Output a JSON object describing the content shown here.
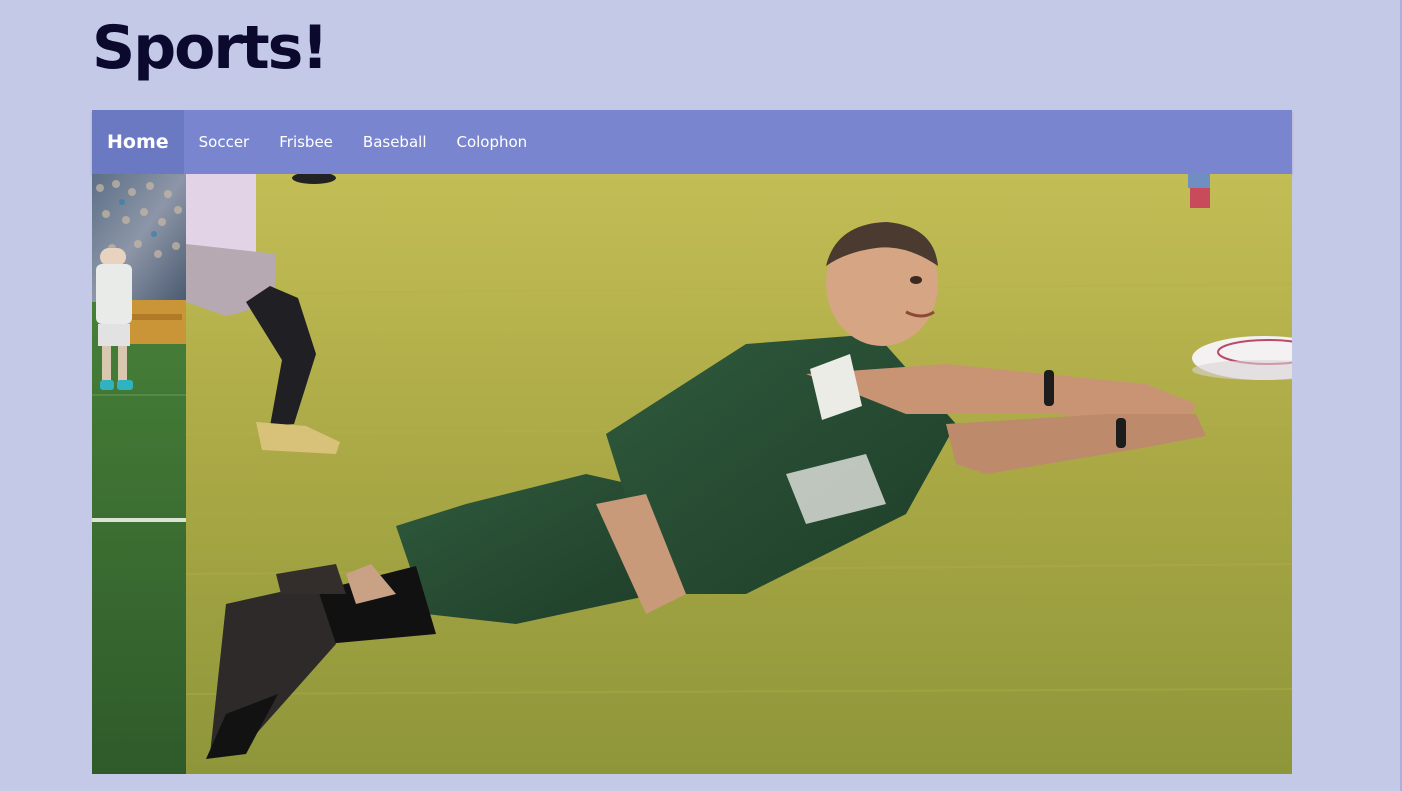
{
  "site": {
    "title": "Sports!"
  },
  "nav": {
    "items": [
      {
        "label": "Home",
        "active": true
      },
      {
        "label": "Soccer",
        "active": false
      },
      {
        "label": "Frisbee",
        "active": false
      },
      {
        "label": "Baseball",
        "active": false
      },
      {
        "label": "Colophon",
        "active": false
      }
    ]
  },
  "slideshow": {
    "slides": [
      {
        "subject": "soccer-player-photo"
      },
      {
        "subject": "frisbee-diving-catch-photo"
      }
    ]
  },
  "colors": {
    "page_background": "#c5c9e8",
    "nav_background": "#7986cf",
    "nav_active_background": "#6b78c2",
    "title_color": "#0b0a2e",
    "grass": "#a9a845"
  }
}
